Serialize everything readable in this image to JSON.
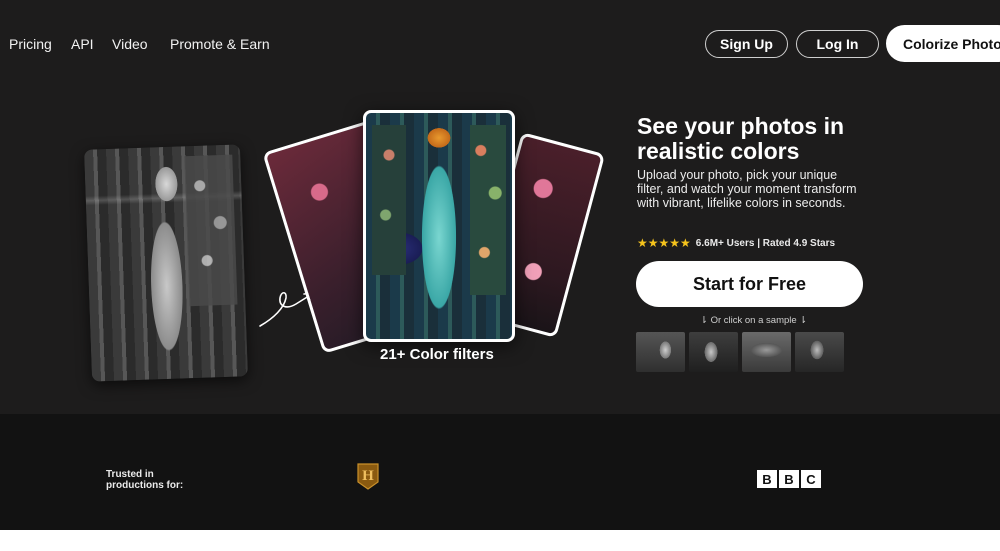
{
  "nav": {
    "links": [
      "Pricing",
      "API",
      "Video",
      "Promote & Earn"
    ],
    "sign_up": "Sign Up",
    "log_in": "Log In",
    "colorize": "Colorize Photo"
  },
  "hero": {
    "title": "See your photos in realistic colors",
    "description": "Upload your photo, pick your unique filter, and watch your moment transform with vibrant, lifelike colors in seconds.",
    "stars": "★★★★★",
    "rating_text": "6.6M+ Users | Rated 4.9 Stars",
    "cta": "Start for Free",
    "sample_hint": "⇂ Or click on a sample ⇂",
    "filters_label": "21+ Color filters"
  },
  "trust": {
    "label": "Trusted in productions for:",
    "logos": [
      "H",
      "BBC"
    ],
    "bbc_letters": [
      "B",
      "B",
      "C"
    ]
  },
  "colors": {
    "hero_bg": "#1d1c1c",
    "trust_bg": "#121212",
    "star": "#f5c31c"
  }
}
